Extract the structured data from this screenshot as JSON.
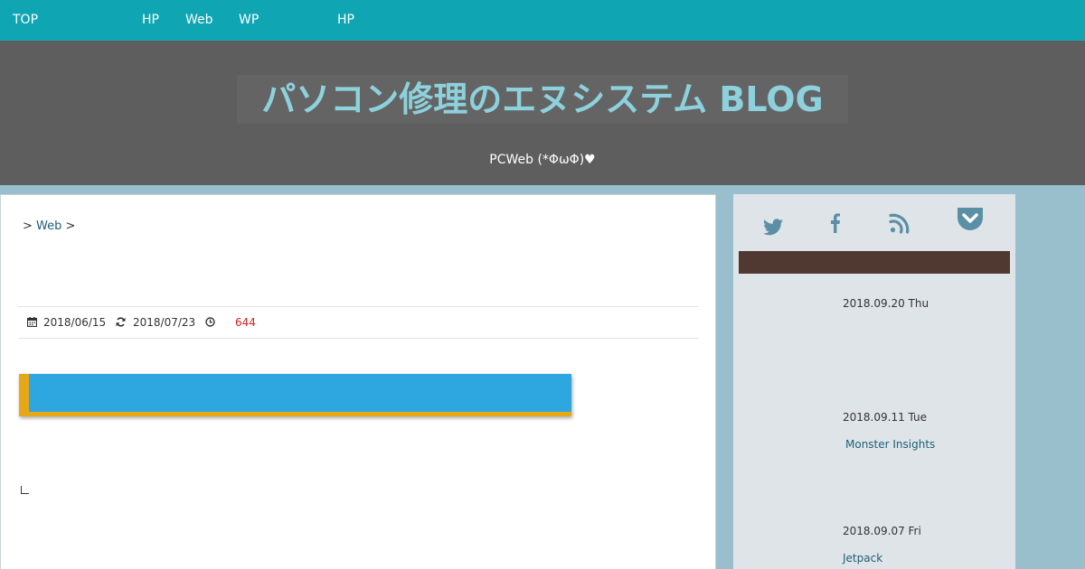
{
  "topnav": {
    "items": [
      "TOP",
      "HP",
      "Web",
      "WP",
      "HP"
    ]
  },
  "header": {
    "title": "パソコン修理のエヌシステム BLOG",
    "description": "PCWeb (*ΦωΦ)♥"
  },
  "breadcrumb": {
    "sep1": ">",
    "category": "Web",
    "sep2": ">"
  },
  "meta": {
    "posted": "2018/06/15",
    "updated": "2018/07/23",
    "views": "644",
    "icons": [
      "calendar-icon",
      "refresh-icon",
      "clock-icon"
    ]
  },
  "sidebar": {
    "social_icons": [
      "twitter-icon",
      "facebook-icon",
      "rss-icon",
      "pocket-icon"
    ],
    "posts": [
      {
        "date": "2018.09.20 Thu",
        "title": ""
      },
      {
        "date": "2018.09.11 Tue",
        "title": "Monster Insights"
      },
      {
        "date": "2018.09.07 Fri",
        "title": "Jetpack"
      }
    ]
  },
  "colors": {
    "nav": "#0fa5b3",
    "header": "#5e5e5e",
    "title": "#8dd1dc",
    "heading_bar": "#2ea7e0",
    "heading_accent": "#e6a817",
    "sidebar_title": "#4f3930",
    "link": "#1d5f75"
  }
}
